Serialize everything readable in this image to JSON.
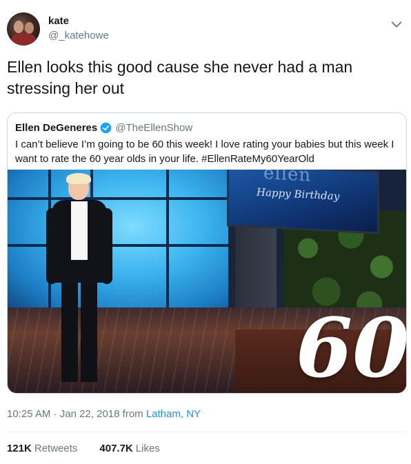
{
  "author": {
    "name": "kate",
    "handle": "@_katehowe"
  },
  "tweet": {
    "text": "Ellen looks this good cause she never had a man stressing her out"
  },
  "quoted": {
    "name": "Ellen DeGeneres",
    "handle": "@TheEllenShow",
    "text": "I can’t believe I’m going to be 60 this week! I love rating your babies but this week I want to rate the 60 year olds in your life. #EllenRateMy60YearOld",
    "media": {
      "screen_logo": "ellen",
      "screen_text": "Happy Birthday",
      "overlay_number": "60"
    }
  },
  "meta": {
    "time": "10:25 AM",
    "separator": "·",
    "date": "Jan 22, 2018",
    "from_label": "from",
    "location": "Latham, NY"
  },
  "stats": {
    "retweets_count": "121K",
    "retweets_label": "Retweets",
    "likes_count": "407.7K",
    "likes_label": "Likes"
  },
  "icons": {
    "caret": "chevron-down-icon",
    "verified": "verified-badge-icon"
  },
  "colors": {
    "link": "#1b95e0",
    "secondary_text": "#657786",
    "verified": "#1da1f2"
  }
}
